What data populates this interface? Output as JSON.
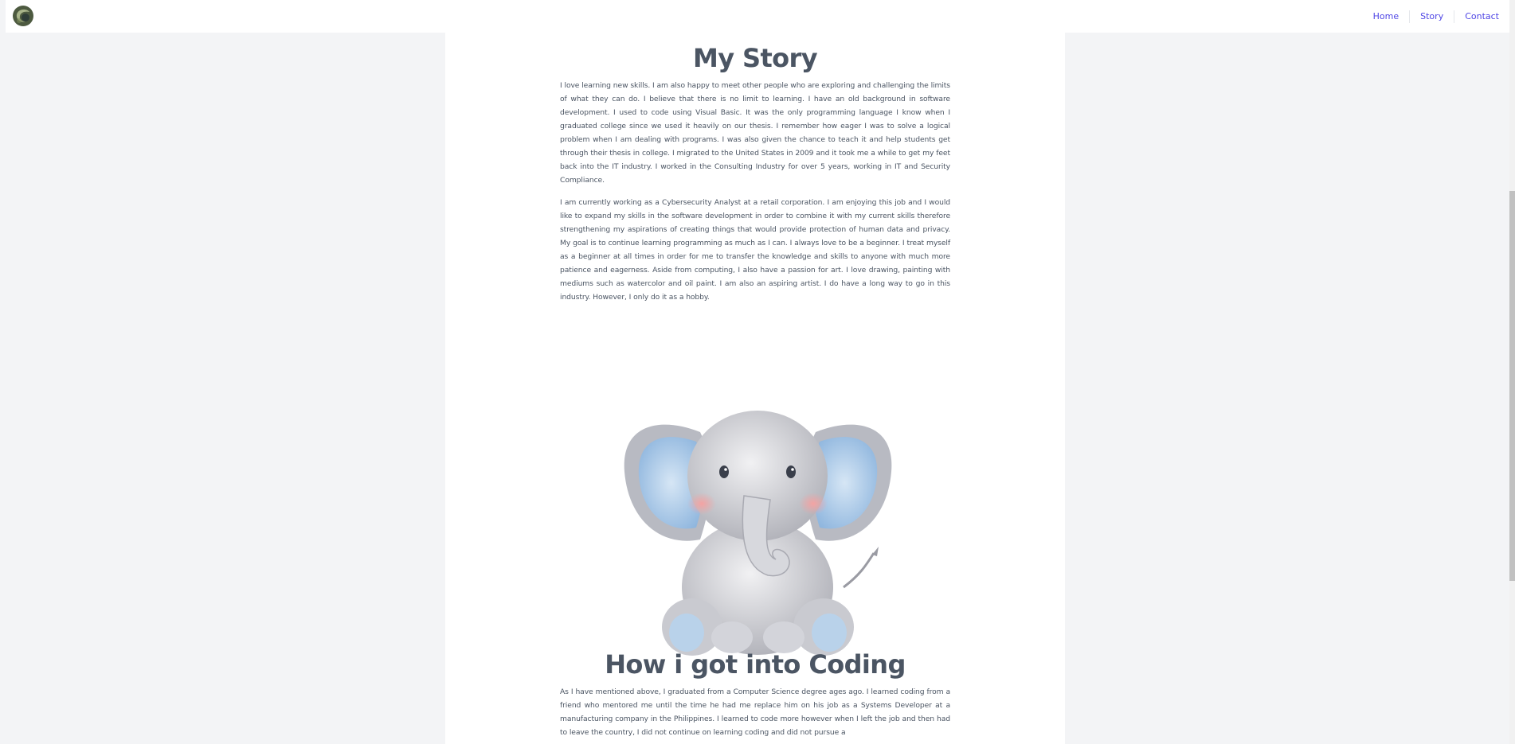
{
  "nav": {
    "links": [
      "Home",
      "Story",
      "Contact"
    ]
  },
  "story": {
    "title": "My Story",
    "paragraphs": [
      "I love learning new skills. I am also happy to meet other people who are exploring and challenging the limits of what they can do. I believe that there is no limit to learning. I have an old background in software development. I used to code using Visual Basic. It was the only programming language I know when I graduated college since we used it heavily on our thesis. I remember how eager I was to solve a logical problem when I am dealing with programs. I was also given the chance to teach it and help students get through their thesis in college. I migrated to the United States in 2009 and it took me a while to get my feet back into the IT industry. I worked in the Consulting Industry for over 5 years, working in IT and Security Compliance.",
      "I am currently working as a Cybersecurity Analyst at a retail corporation. I am enjoying this job and I would like to expand my skills in the software development in order to combine it with my current skills therefore strengthening my aspirations of creating things that would provide protection of human data and privacy. My goal is to continue learning programming as much as I can. I always love to be a beginner. I treat myself as a beginner at all times in order for me to transfer the knowledge and skills to anyone with much more patience and eagerness. Aside from computing, I also have a passion for art. I love drawing, painting with mediums such as watercolor and oil paint. I am also an aspiring artist. I do have a long way to go in this industry. However, I only do it as a hobby."
    ]
  },
  "coding": {
    "title": "How i got into Coding",
    "paragraphs": [
      "As I have mentioned above, I graduated from a Computer Science degree ages ago. I learned coding from a friend who mentored me until the time he had me replace him on his job as a Systems Developer at a manufacturing company in the Philippines. I learned to code more however when I left the job and then had to leave the country, I did not continue on learning coding and did not pursue a"
    ]
  },
  "colors": {
    "background": "#f3f4f6",
    "nav_link": "#4f46e5",
    "heading": "#4b5563",
    "body_text": "#4b5563"
  },
  "icons": {
    "logo": "logo-icon",
    "illustration": "elephant-illustration"
  }
}
